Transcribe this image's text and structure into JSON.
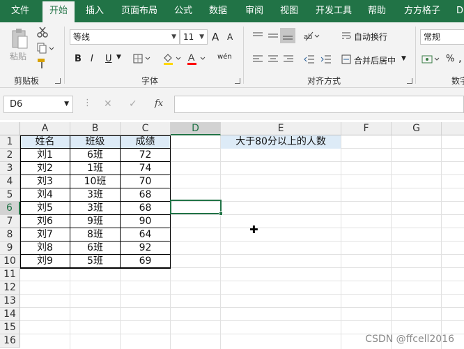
{
  "tabs": [
    "文件",
    "开始",
    "插入",
    "页面布局",
    "公式",
    "数据",
    "审阅",
    "视图",
    "开发工具",
    "帮助",
    "方方格子",
    "DI"
  ],
  "active_tab": "开始",
  "clipboard": {
    "paste_label": "粘贴",
    "group_label": "剪贴板"
  },
  "font": {
    "name": "等线",
    "size": "11",
    "group_label": "字体",
    "bold": "B",
    "italic": "I",
    "underline": "U",
    "grow": "A",
    "shrink": "A",
    "phonetic": "wén",
    "font_color_letter": "A"
  },
  "alignment": {
    "wrap_label": "自动换行",
    "merge_label": "合并后居中",
    "group_label": "对齐方式"
  },
  "number": {
    "format": "常规",
    "group_label": "数字",
    "percent": "%",
    "comma": ","
  },
  "name_box": "D6",
  "formula_icons": {
    "cancel": "✕",
    "enter": "✓",
    "fx": "fx"
  },
  "columns": [
    "A",
    "B",
    "C",
    "D",
    "E",
    "F",
    "G"
  ],
  "rows": [
    "1",
    "2",
    "3",
    "4",
    "5",
    "6",
    "7",
    "8",
    "9",
    "10",
    "11",
    "12",
    "13",
    "14",
    "15",
    "16"
  ],
  "table": {
    "headers": [
      "姓名",
      "班级",
      "成绩"
    ],
    "rows": [
      [
        "刘1",
        "6班",
        "72"
      ],
      [
        "刘2",
        "1班",
        "74"
      ],
      [
        "刘3",
        "10班",
        "70"
      ],
      [
        "刘4",
        "3班",
        "68"
      ],
      [
        "刘5",
        "3班",
        "68"
      ],
      [
        "刘6",
        "9班",
        "90"
      ],
      [
        "刘7",
        "8班",
        "64"
      ],
      [
        "刘8",
        "6班",
        "92"
      ],
      [
        "刘9",
        "5班",
        "69"
      ]
    ]
  },
  "e1_text": "大于80分以上的人数",
  "watermark": "CSDN @ffcell2016",
  "colors": {
    "ribbon_green": "#217346",
    "header_fill": "#ddebf7"
  }
}
